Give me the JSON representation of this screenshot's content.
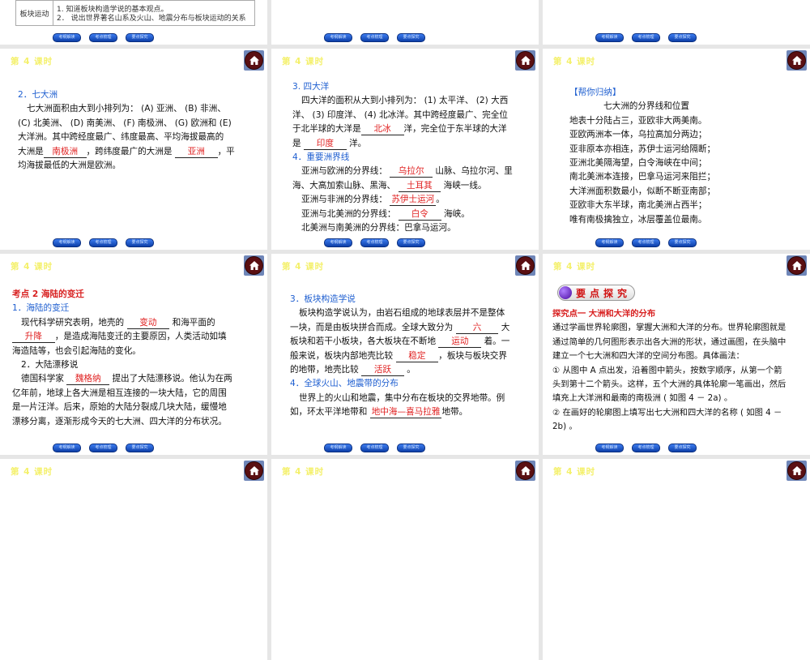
{
  "slide_title": "第 4 课时",
  "nav_buttons": [
    "考纲解读",
    "考点梳理",
    "要点探究"
  ],
  "top_table": {
    "key": "板块运动",
    "lines": [
      "1. 知道板块构造学说的基本观点。",
      "2． 说出世界著名山系及火山、地震分布与板块运动的关系"
    ]
  },
  "slides": [
    {
      "lines": [
        {
          "type": "h",
          "seg": [
            "2．七大洲"
          ]
        },
        {
          "type": "pi",
          "seg": [
            "七大洲面积由大到小排列为： (A) 亚洲、 (B) 非洲、"
          ]
        },
        {
          "type": "p",
          "seg": [
            "(C) 北美洲、 (D) 南美洲、 (F) 南极洲、 (G) 欧洲和 (E)"
          ]
        },
        {
          "type": "p",
          "seg": [
            "大洋洲。其中跨经度最广、纬度最高、平均海拔最高的"
          ]
        },
        {
          "type": "p",
          "seg": [
            "大洲是",
            {
              "blank": "南极洲"
            },
            "，跨纬度最广的大洲是 ",
            {
              "blank": "亚洲"
            },
            "，平"
          ]
        },
        {
          "type": "p",
          "seg": [
            "均海拔最低的大洲是欧洲。"
          ]
        }
      ]
    },
    {
      "lines": [
        {
          "type": "h",
          "seg": [
            "3. 四大洋"
          ]
        },
        {
          "type": "pi",
          "seg": [
            "四大洋的面积从大到小排列为： (1) 太平洋、 (2) 大西"
          ]
        },
        {
          "type": "p",
          "seg": [
            "洋、 (3) 印度洋、 (4) 北冰洋。其中跨经度最广、完全位"
          ]
        },
        {
          "type": "p",
          "seg": [
            "于北半球的大洋是",
            {
              "blank": "北冰"
            },
            "洋，完全位于东半球的大洋"
          ]
        },
        {
          "type": "p",
          "seg": [
            "是 ",
            {
              "blank": "印度"
            },
            " 洋。"
          ]
        },
        {
          "type": "h",
          "seg": [
            "4．重要洲界线"
          ]
        },
        {
          "type": "pi",
          "seg": [
            "亚洲与欧洲的分界线： ",
            {
              "blank": "乌拉尔"
            },
            " 山脉、乌拉尔河、里"
          ]
        },
        {
          "type": "p",
          "seg": [
            "海、大高加索山脉、黑海、 ",
            {
              "blank": "土耳其"
            },
            " 海峡一线。"
          ]
        },
        {
          "type": "pi",
          "seg": [
            "亚洲与非洲的分界线： ",
            {
              "blank": "苏伊士运河"
            },
            "。"
          ]
        },
        {
          "type": "pi",
          "seg": [
            "亚洲与北美洲的分界线： ",
            {
              "blank": "白令"
            },
            " 海峡。"
          ]
        },
        {
          "type": "pi",
          "seg": [
            "北美洲与南美洲的分界线：巴拿马运河。"
          ]
        }
      ]
    },
    {
      "lines": [
        {
          "type": "h",
          "seg": [
            "【帮你归纳】"
          ]
        },
        {
          "type": "c",
          "seg": [
            "七大洲的分界线和位置"
          ]
        },
        {
          "type": "p",
          "seg": [
            "地表十分陆占三，亚欧非大两美南。"
          ]
        },
        {
          "type": "p",
          "seg": [
            "亚欧两洲本一体，乌拉高加分两边；"
          ]
        },
        {
          "type": "p",
          "seg": [
            "亚非原本亦相连，苏伊士运河给隔断；"
          ]
        },
        {
          "type": "p",
          "seg": [
            "亚洲北美隔海望，白令海峡在中间；"
          ]
        },
        {
          "type": "p",
          "seg": [
            "南北美洲本连接，巴拿马运河来阻拦；"
          ]
        },
        {
          "type": "p",
          "seg": [
            "大洋洲面积数最小，似断不断亚南部；"
          ]
        },
        {
          "type": "p",
          "seg": [
            "亚欧非大东半球，南北美洲占西半；"
          ]
        },
        {
          "type": "p",
          "seg": [
            "唯有南极擒独立，冰层覆盖位最南。"
          ]
        }
      ]
    },
    {
      "lines": [
        {
          "type": "hr",
          "seg": [
            "考点  2    海陆的变迁"
          ]
        },
        {
          "type": "h",
          "seg": [
            "  1．海陆的变迁"
          ]
        },
        {
          "type": "pi",
          "seg": [
            "现代科学研究表明，地壳的 ",
            {
              "blank": "变动"
            },
            " 和海平面的"
          ]
        },
        {
          "type": "p",
          "seg": [
            {
              "blank": "升降"
            },
            "，是造成海陆变迁的主要原因，人类活动如填"
          ]
        },
        {
          "type": "p",
          "seg": [
            "海造陆等，也会引起海陆的变化。"
          ]
        },
        {
          "type": "pi",
          "seg": [
            "2．大陆漂移说"
          ]
        },
        {
          "type": "pi",
          "seg": [
            "德国科学家 ",
            {
              "blank": "魏格纳"
            },
            " 提出了大陆漂移说。他认为在两"
          ]
        },
        {
          "type": "p",
          "seg": [
            "亿年前，地球上各大洲是相互连接的一块大陆，它的周围"
          ]
        },
        {
          "type": "p",
          "seg": [
            "是一片汪洋。后来，原始的大陆分裂成几块大陆，缓慢地"
          ]
        },
        {
          "type": "p",
          "seg": [
            "漂移分离，逐渐形成今天的七大洲、四大洋的分布状况。"
          ]
        }
      ]
    },
    {
      "lines": [
        {
          "type": "h",
          "seg": [
            "3．板块构造学说"
          ]
        },
        {
          "type": "pi",
          "seg": [
            "板块构造学说认为，由岩石组成的地球表层并不是整体"
          ]
        },
        {
          "type": "p",
          "seg": [
            "一块，而是由板块拼合而成。全球大致分为 ",
            {
              "blank": "六"
            },
            " 大"
          ]
        },
        {
          "type": "p",
          "seg": [
            "板块和若干小板块，各大板块在不断地 ",
            {
              "blank": "运动"
            },
            " 着。一"
          ]
        },
        {
          "type": "p",
          "seg": [
            "般来说，板块内部地壳比较 ",
            {
              "blank": "稳定"
            },
            "，板块与板块交界"
          ]
        },
        {
          "type": "p",
          "seg": [
            "的地带，地壳比较 ",
            {
              "blank": "活跃"
            },
            " 。"
          ]
        },
        {
          "type": "h",
          "seg": [
            "4．全球火山、地震带的分布"
          ]
        },
        {
          "type": "pi",
          "seg": [
            "世界上的火山和地震，集中分布在板块的交界地带。例"
          ]
        },
        {
          "type": "p",
          "seg": [
            "如，环太平洋地带和 ",
            {
              "blank": "地中海—喜马拉雅"
            },
            "地带。"
          ]
        }
      ]
    },
    {
      "badge": "要点探究",
      "lines": [
        {
          "type": "hr",
          "seg": [
            "探究点一    大洲和大洋的分布"
          ]
        },
        {
          "type": "p",
          "seg": [
            "通过学画世界轮廓图，掌握大洲和大洋的分布。世界轮廓图就是"
          ]
        },
        {
          "type": "p",
          "seg": [
            "通过简单的几何图形表示出各大洲的形状，通过画图，在头脑中"
          ]
        },
        {
          "type": "p",
          "seg": [
            "建立一个七大洲和四大洋的空间分布图。具体画法："
          ]
        },
        {
          "type": "p",
          "seg": [
            "① 从图中 A 点出发，沿着图中箭头，按数字顺序，从第一个箭"
          ]
        },
        {
          "type": "p",
          "seg": [
            "头到第十二个箭头。这样，五个大洲的具体轮廓一笔画出，然后"
          ]
        },
        {
          "type": "p",
          "seg": [
            "填充上大洋洲和最南的南极洲 ( 如图 4 － 2a) 。"
          ]
        },
        {
          "type": "p",
          "seg": [
            "② 在画好的轮廓图上填写出七大洲和四大洋的名称 ( 如图 4 －"
          ]
        },
        {
          "type": "p",
          "seg": [
            "2b) 。"
          ]
        }
      ]
    }
  ]
}
